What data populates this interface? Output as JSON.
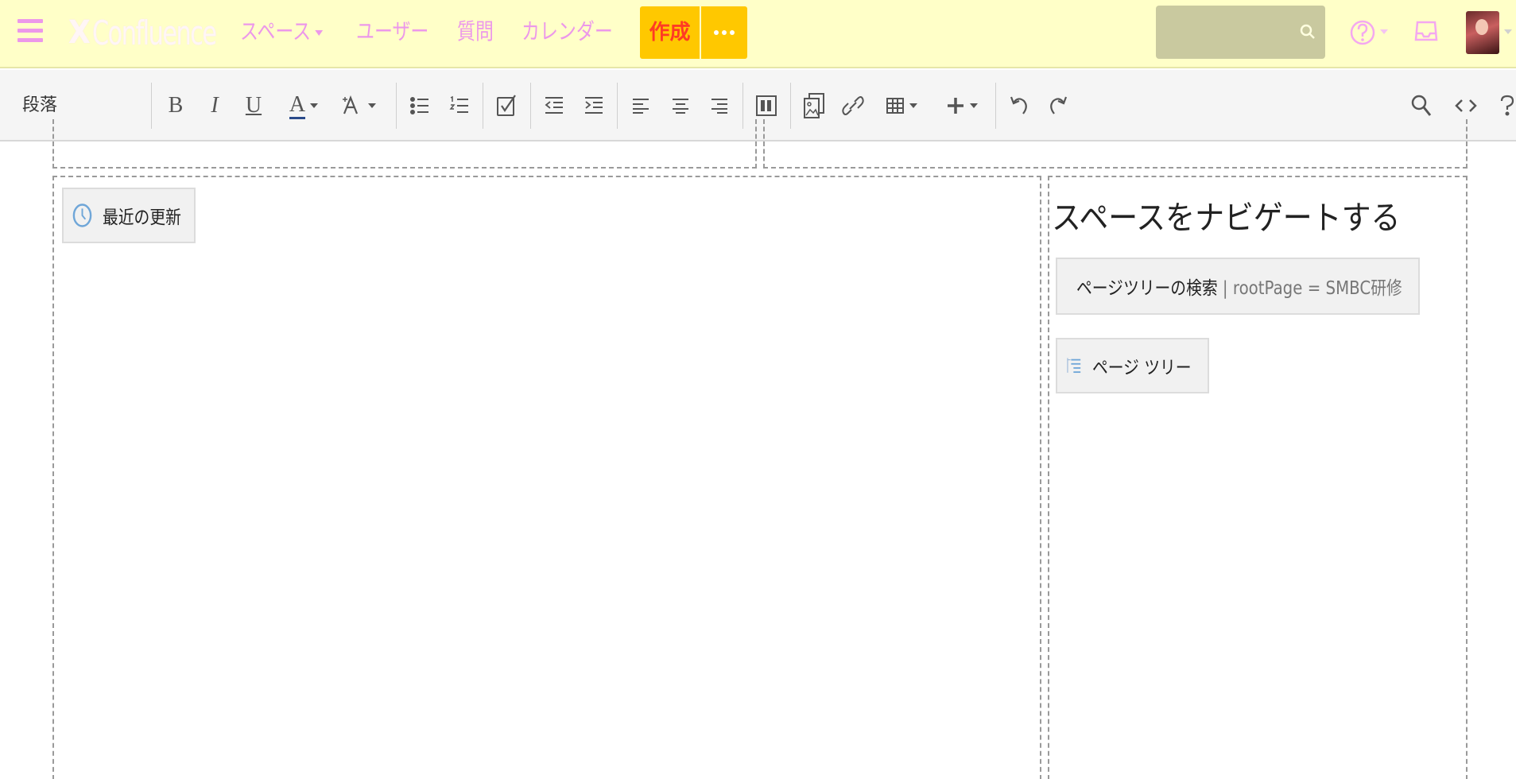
{
  "topbar": {
    "logo_mark": "X",
    "logo_text": "Confluence",
    "nav": {
      "spaces": "スペース",
      "users": "ユーザー",
      "questions": "質問",
      "calendar": "カレンダー"
    },
    "create_label": "作成"
  },
  "toolbar": {
    "paragraph_format": "段落",
    "bold": "B",
    "italic": "I",
    "underline": "U",
    "text_color": "A"
  },
  "content": {
    "recent_updates_label": "最近の更新",
    "navigate_heading": "スペースをナビゲートする",
    "pagetree_search_label": "ページツリーの検索",
    "pagetree_search_param": " | rootPage = SMBC研修",
    "pagetree_label": "ページ ツリー"
  },
  "colors": {
    "topbar_bg": "#ffffc8",
    "nav_text": "#ec98ea",
    "create_bg": "#ffc800",
    "create_text": "#ff3b24",
    "search_bg": "#c9c99f"
  },
  "icons": [
    "menu-icon",
    "search-icon",
    "help-icon",
    "inbox-icon",
    "clock-icon",
    "pagetree-search-icon",
    "pagetree-icon"
  ]
}
